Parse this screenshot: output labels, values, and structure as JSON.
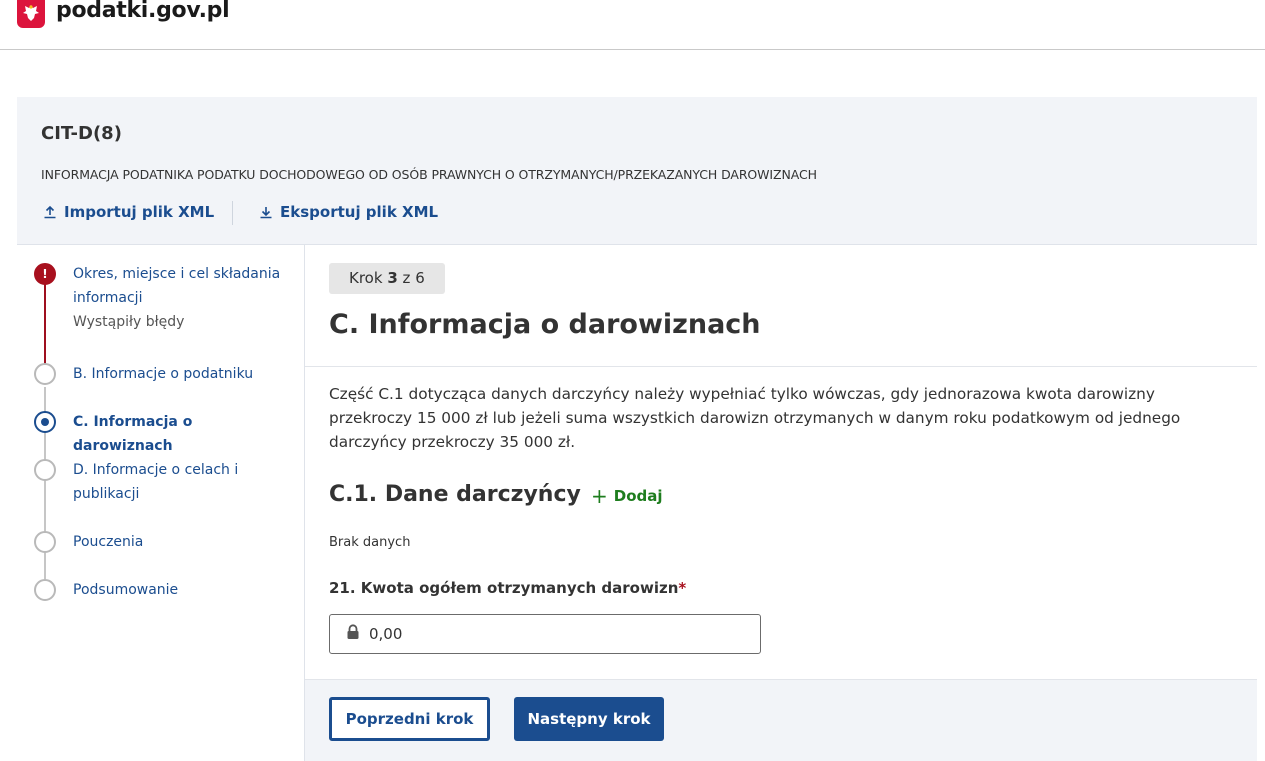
{
  "header": {
    "site_name": "podatki.gov.pl",
    "emblem_icon": "polish-eagle-emblem-icon",
    "brand_color": "#dc143c"
  },
  "form": {
    "code": "CIT-D(8)",
    "description": "INFORMACJA PODATNIKA PODATKU DOCHODOWEGO OD OSÓB PRAWNYCH O OTRZYMANYCH/PRZEKAZANYCH DAROWIZNACH",
    "import_label": "Importuj plik XML",
    "export_label": "Eksportuj plik XML",
    "import_icon": "upload-icon",
    "export_icon": "download-icon"
  },
  "steps": {
    "items": [
      {
        "label": "Okres, miejsce i cel składania informacji",
        "state": "error",
        "error_text": "Wystąpiły błędy"
      },
      {
        "label": "B. Informacje o podatniku",
        "state": "default"
      },
      {
        "label": "C. Informacja o darowiznach",
        "state": "active"
      },
      {
        "label": "D. Informacje o celach i publikacji",
        "state": "default"
      },
      {
        "label": "Pouczenia",
        "state": "default"
      },
      {
        "label": "Podsumowanie",
        "state": "default"
      }
    ],
    "error_mark": "!"
  },
  "main": {
    "step_prefix": "Krok",
    "step_current": "3",
    "step_suffix": "z 6",
    "title": "C. Informacja o darowiznach",
    "info": "Część C.1 dotycząca danych darczyńcy należy wypełniać tylko wówczas, gdy jednorazowa kwota darowizny przekroczy 15 000 zł lub jeżeli suma wszystkich darowizn otrzymanych w danym roku podatkowym od jednego darczyńcy przekroczy 35 000 zł.",
    "subsection_title": "C.1. Dane darczyńcy",
    "add_label": "Dodaj",
    "no_data": "Brak danych",
    "field_label": "21. Kwota ogółem otrzymanych darowizn",
    "field_required_mark": "*",
    "field_value": "0,00",
    "field_icon": "lock-icon"
  },
  "footer": {
    "prev_label": "Poprzedni krok",
    "next_label": "Następny krok"
  },
  "colors": {
    "primary": "#1b4d8f",
    "error": "#a8101e",
    "success": "#1e7d1e",
    "panel_bg": "#f2f4f8"
  }
}
